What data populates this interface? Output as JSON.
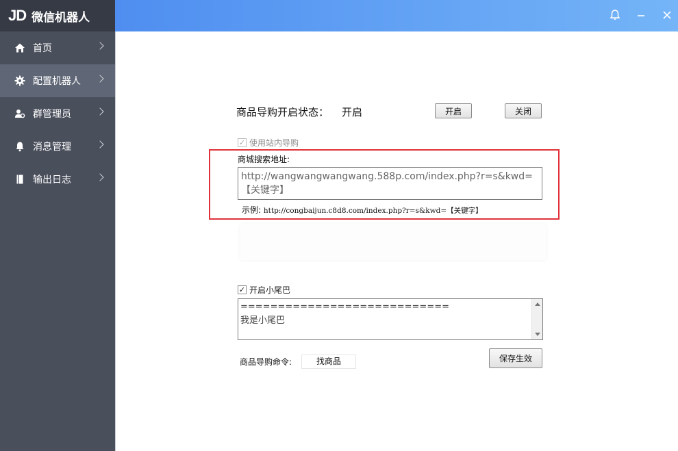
{
  "app": {
    "logo": "JD",
    "title": "微信机器人"
  },
  "sidebar": {
    "items": [
      {
        "label": "首页",
        "icon": "home-icon"
      },
      {
        "label": "配置机器人",
        "icon": "gear-icon"
      },
      {
        "label": "群管理员",
        "icon": "users-icon"
      },
      {
        "label": "消息管理",
        "icon": "bell-icon"
      },
      {
        "label": "输出日志",
        "icon": "notebook-icon"
      }
    ],
    "active_index": 1
  },
  "topbar": {
    "icons": [
      "bell-icon",
      "minimize-icon",
      "close-icon"
    ]
  },
  "config": {
    "status_label": "商品导购开启状态：",
    "status_value": "开启",
    "open_button": "开启",
    "close_button": "关闭",
    "use_internal_label": "使用站内导购",
    "use_internal_checked": true,
    "mall_url_label": "商城搜索地址:",
    "mall_url_value": "http://wangwangwangwang.588p.com/index.php?r=s&kwd=【关键字】",
    "example_label": "示例:",
    "example_value": "http://congbaijun.c8d8.com/index.php?r=s&kwd=【关键字】",
    "tail_label": "开启小尾巴",
    "tail_checked": true,
    "tail_line1": "============================",
    "tail_line2": "我是小尾巴",
    "cmd_label": "商品导购命令:",
    "cmd_value": "找商品",
    "save_button": "保存生效"
  },
  "colors": {
    "sidebar_bg": "#4a4f5c",
    "brand_bg": "#363a45",
    "active_item": "#5f6675",
    "topbar_start": "#4f8ef0",
    "topbar_end": "#74b4f7",
    "highlight": "#e0313b"
  }
}
